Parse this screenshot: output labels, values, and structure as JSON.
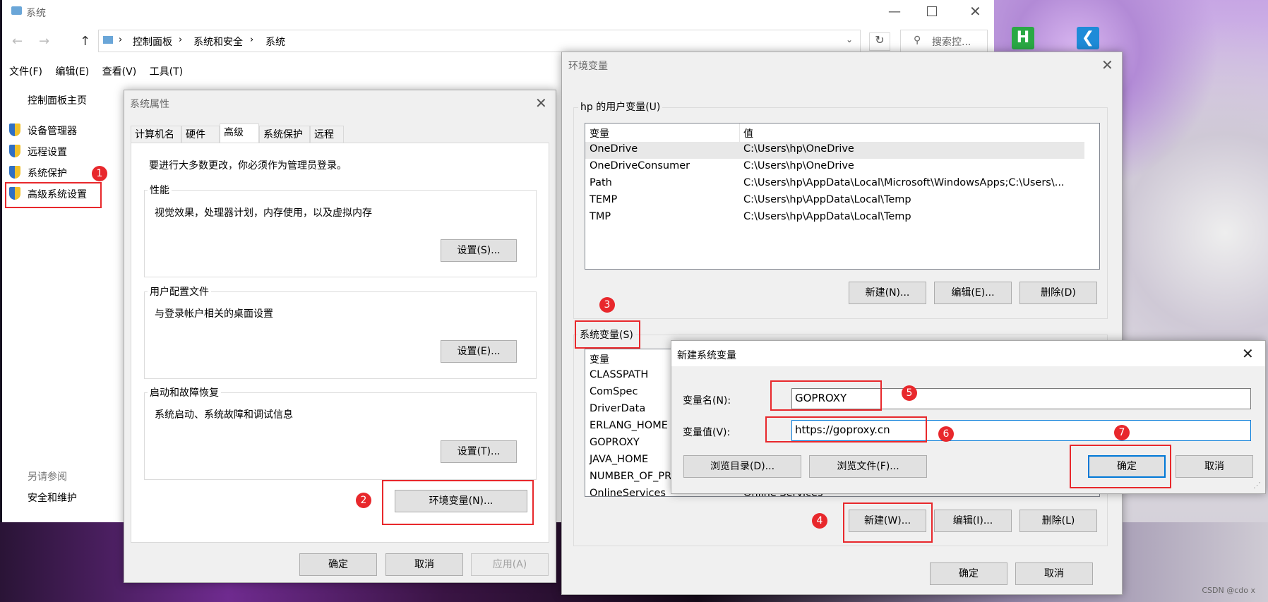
{
  "desktop": {
    "icons": [
      {
        "name": "hbuilder-icon",
        "glyph": "H",
        "color": "#2aa944"
      },
      {
        "name": "vscode-icon",
        "glyph": "❮",
        "color": "#1e8bd8"
      }
    ],
    "credit": "CSDN @cdo x"
  },
  "system_window": {
    "title": "系统",
    "breadcrumb": [
      "控制面板",
      "系统和安全",
      "系统"
    ],
    "search_placeholder": "搜索控...",
    "menu": [
      "文件(F)",
      "编辑(E)",
      "查看(V)",
      "工具(T)"
    ],
    "left_nav": {
      "home": "控制面板主页",
      "items": [
        "设备管理器",
        "远程设置",
        "系统保护",
        "高级系统设置"
      ],
      "see_also": "另请参阅",
      "security": "安全和维护"
    }
  },
  "system_properties": {
    "title": "系统属性",
    "tabs": [
      "计算机名",
      "硬件",
      "高级",
      "系统保护",
      "远程"
    ],
    "admin_note": "要进行大多数更改，你必须作为管理员登录。",
    "performance": {
      "label": "性能",
      "desc": "视觉效果，处理器计划，内存使用，以及虚拟内存",
      "button": "设置(S)..."
    },
    "profiles": {
      "label": "用户配置文件",
      "desc": "与登录帐户相关的桌面设置",
      "button": "设置(E)..."
    },
    "startup": {
      "label": "启动和故障恢复",
      "desc": "系统启动、系统故障和调试信息",
      "button": "设置(T)..."
    },
    "env_button": "环境变量(N)...",
    "ok": "确定",
    "cancel": "取消",
    "apply": "应用(A)"
  },
  "env_vars": {
    "title": "环境变量",
    "user_label": "hp 的用户变量(U)",
    "col_var": "变量",
    "col_val": "值",
    "user_rows": [
      {
        "name": "OneDrive",
        "value": "C:\\Users\\hp\\OneDrive"
      },
      {
        "name": "OneDriveConsumer",
        "value": "C:\\Users\\hp\\OneDrive"
      },
      {
        "name": "Path",
        "value": "C:\\Users\\hp\\AppData\\Local\\Microsoft\\WindowsApps;C:\\Users\\..."
      },
      {
        "name": "TEMP",
        "value": "C:\\Users\\hp\\AppData\\Local\\Temp"
      },
      {
        "name": "TMP",
        "value": "C:\\Users\\hp\\AppData\\Local\\Temp"
      }
    ],
    "user_buttons": [
      "新建(N)...",
      "编辑(E)...",
      "删除(D)"
    ],
    "system_label": "系统变量(S)",
    "system_rows": [
      "CLASSPATH",
      "ComSpec",
      "DriverData",
      "ERLANG_HOME",
      "GOPROXY",
      "JAVA_HOME",
      "NUMBER_OF_PR",
      "OnlineServices"
    ],
    "system_row_last_value": "Online Services",
    "system_buttons": [
      "新建(W)...",
      "编辑(I)...",
      "删除(L)"
    ],
    "ok": "确定",
    "cancel": "取消"
  },
  "new_var": {
    "title": "新建系统变量",
    "name_label": "变量名(N):",
    "name_value": "GOPROXY",
    "value_label": "变量值(V):",
    "value_value": "https://goproxy.cn",
    "browse_dir": "浏览目录(D)...",
    "browse_file": "浏览文件(F)...",
    "ok": "确定",
    "cancel": "取消"
  },
  "annotations": [
    "1",
    "2",
    "3",
    "4",
    "5",
    "6",
    "7"
  ],
  "colors": {
    "annotation": "#e8282c",
    "focus": "#0078d7"
  }
}
